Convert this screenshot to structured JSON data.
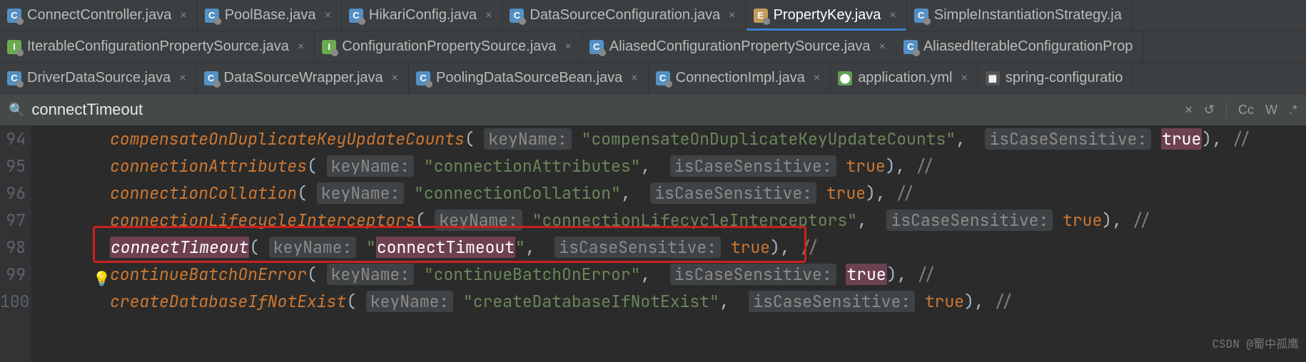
{
  "tabRows": [
    [
      {
        "icon": "class",
        "label": "ConnectController.java",
        "closable": true,
        "active": false
      },
      {
        "icon": "class",
        "label": "PoolBase.java",
        "closable": true,
        "active": false
      },
      {
        "icon": "class",
        "label": "HikariConfig.java",
        "closable": true,
        "active": false
      },
      {
        "icon": "class",
        "label": "DataSourceConfiguration.java",
        "closable": true,
        "active": false
      },
      {
        "icon": "enum",
        "label": "PropertyKey.java",
        "closable": true,
        "active": true
      },
      {
        "icon": "class",
        "label": "SimpleInstantiationStrategy.ja",
        "closable": false,
        "active": false
      }
    ],
    [
      {
        "icon": "interface",
        "label": "IterableConfigurationPropertySource.java",
        "closable": true,
        "active": false
      },
      {
        "icon": "interface",
        "label": "ConfigurationPropertySource.java",
        "closable": true,
        "active": false
      },
      {
        "icon": "class",
        "label": "AliasedConfigurationPropertySource.java",
        "closable": true,
        "active": false
      },
      {
        "icon": "class",
        "label": "AliasedIterableConfigurationProp",
        "closable": false,
        "active": false
      }
    ],
    [
      {
        "icon": "class",
        "label": "DriverDataSource.java",
        "closable": true,
        "active": false
      },
      {
        "icon": "class",
        "label": "DataSourceWrapper.java",
        "closable": true,
        "active": false
      },
      {
        "icon": "class",
        "label": "PoolingDataSourceBean.java",
        "closable": true,
        "active": false
      },
      {
        "icon": "class",
        "label": "ConnectionImpl.java",
        "closable": true,
        "active": false
      },
      {
        "icon": "yml",
        "label": "application.yml",
        "closable": true,
        "active": false
      },
      {
        "icon": "file",
        "label": "spring-configuratio",
        "closable": false,
        "active": false
      }
    ]
  ],
  "search": {
    "query": "connectTimeout",
    "actions": {
      "close": "×",
      "undo": "↺",
      "case": "Cc",
      "word": "W",
      "regex": ".*"
    }
  },
  "code": {
    "hintKey": "keyName:",
    "hintCase": "isCaseSensitive:",
    "boolTrue": "true",
    "commentSlash": "//",
    "lines": [
      {
        "n": 94,
        "name": "compensateOnDuplicateKeyUpdateCounts",
        "str": "compensateOnDuplicateKeyUpdateCounts",
        "boolHl": true
      },
      {
        "n": 95,
        "name": "connectionAttributes",
        "str": "connectionAttributes"
      },
      {
        "n": 96,
        "name": "connectionCollation",
        "str": "connectionCollation"
      },
      {
        "n": 97,
        "name": "connectionLifecycleInterceptors",
        "str": "connectionLifecycleInterceptors"
      },
      {
        "n": 98,
        "name": "connectTimeout",
        "str": "connectTimeout",
        "highlight": true,
        "boxed": true
      },
      {
        "n": 99,
        "name": "continueBatchOnError",
        "str": "continueBatchOnError",
        "boolHl": true,
        "bulb": true
      },
      {
        "n": 100,
        "name": "createDatabaseIfNotExist",
        "str": "createDatabaseIfNotExist"
      }
    ]
  },
  "watermark": "CSDN @蜀中孤鹰"
}
